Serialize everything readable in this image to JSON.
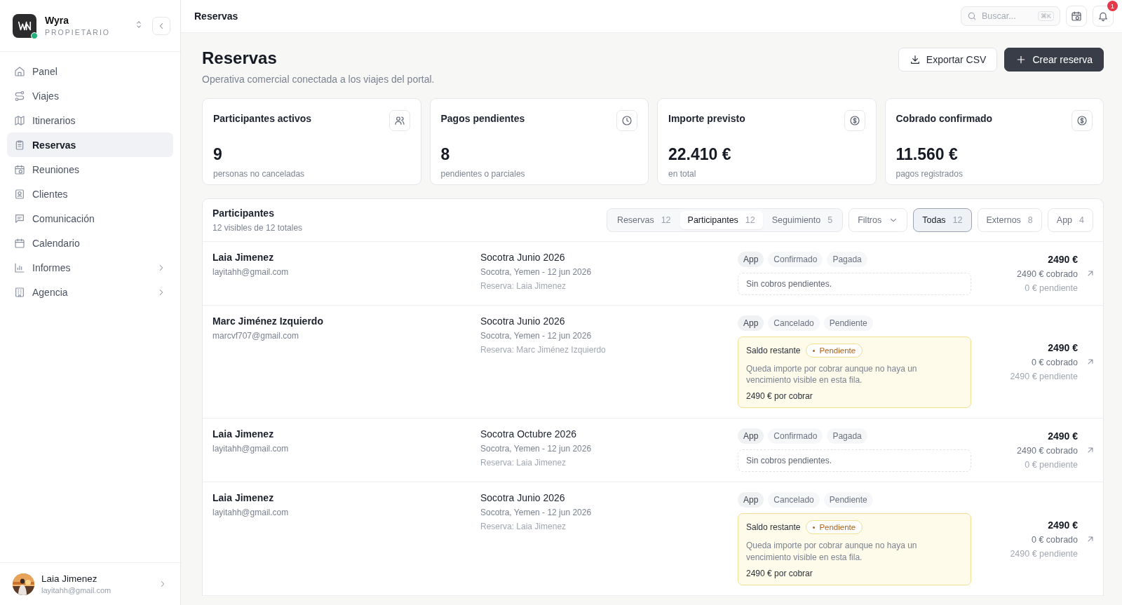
{
  "sidebar": {
    "brand": {
      "name": "Wyra",
      "role": "PROPIETARIO"
    },
    "items": [
      {
        "label": "Panel",
        "selected": false,
        "expandable": false
      },
      {
        "label": "Viajes",
        "selected": false,
        "expandable": false
      },
      {
        "label": "Itinerarios",
        "selected": false,
        "expandable": false
      },
      {
        "label": "Reservas",
        "selected": true,
        "expandable": false
      },
      {
        "label": "Reuniones",
        "selected": false,
        "expandable": false
      },
      {
        "label": "Clientes",
        "selected": false,
        "expandable": false
      },
      {
        "label": "Comunicación",
        "selected": false,
        "expandable": false
      },
      {
        "label": "Calendario",
        "selected": false,
        "expandable": false
      },
      {
        "label": "Informes",
        "selected": false,
        "expandable": true
      },
      {
        "label": "Agencia",
        "selected": false,
        "expandable": true
      }
    ],
    "user": {
      "name": "Laia Jimenez",
      "email": "layitahh@gmail.com"
    }
  },
  "topbar": {
    "title": "Reservas",
    "search": {
      "placeholder": "Buscar...",
      "shortcut": "⌘K"
    },
    "notifications": "1"
  },
  "header": {
    "title": "Reservas",
    "subtitle": "Operativa comercial conectada a los viajes del portal.",
    "buttons": [
      {
        "label": "Exportar CSV",
        "kind": "secondary"
      },
      {
        "label": "Crear reserva",
        "kind": "primary"
      }
    ]
  },
  "stats": [
    {
      "title": "Participantes activos",
      "value": "9",
      "caption": "personas no canceladas"
    },
    {
      "title": "Pagos pendientes",
      "value": "8",
      "caption": "pendientes o parciales"
    },
    {
      "title": "Importe previsto",
      "value": "22.410 €",
      "caption": "en total"
    },
    {
      "title": "Cobrado confirmado",
      "value": "11.560 €",
      "caption": "pagos registrados"
    }
  ],
  "participants": {
    "title": "Participantes",
    "subtitle": "12 visibles de 12 totales",
    "view_tabs": [
      {
        "label": "Reservas",
        "count": "12",
        "selected": false
      },
      {
        "label": "Participantes",
        "count": "12",
        "selected": true
      },
      {
        "label": "Seguimiento",
        "count": "5",
        "selected": false
      }
    ],
    "filters_button": "Filtros",
    "segments": [
      {
        "label": "Todas",
        "count": "12",
        "selected": true
      },
      {
        "label": "Externos",
        "count": "8",
        "selected": false
      },
      {
        "label": "App",
        "count": "4",
        "selected": false
      }
    ],
    "rows": [
      {
        "name": "Laia Jimenez",
        "email": "layitahh@gmail.com",
        "trip": "Socotra Junio 2026",
        "place_date": "Socotra, Yemen - 12 jun 2026",
        "reservation": "Reserva: Laia Jimenez",
        "tags": [
          {
            "label": "App",
            "kind": "source"
          },
          {
            "label": "Confirmado",
            "kind": "status"
          },
          {
            "label": "Pagada",
            "kind": "status"
          }
        ],
        "payment": {
          "kind": "none",
          "text": "Sin cobros pendientes."
        },
        "total": "2490 €",
        "collected": "2490 € cobrado",
        "pending": "0 € pendiente"
      },
      {
        "name": "Marc Jiménez Izquierdo",
        "email": "marcvf707@gmail.com",
        "trip": "Socotra Junio 2026",
        "place_date": "Socotra, Yemen - 12 jun 2026",
        "reservation": "Reserva: Marc Jiménez Izquierdo",
        "tags": [
          {
            "label": "App",
            "kind": "source"
          },
          {
            "label": "Cancelado",
            "kind": "status"
          },
          {
            "label": "Pendiente",
            "kind": "status"
          }
        ],
        "payment": {
          "kind": "pending",
          "title": "Saldo restante",
          "badge": "Pendiente",
          "text": "Queda importe por cobrar aunque no haya un vencimiento visible en esta fila.",
          "amount": "2490 € por cobrar"
        },
        "total": "2490 €",
        "collected": "0 € cobrado",
        "pending": "2490 € pendiente"
      },
      {
        "name": "Laia Jimenez",
        "email": "layitahh@gmail.com",
        "trip": "Socotra Octubre 2026",
        "place_date": "Socotra, Yemen - 12 jun 2026",
        "reservation": "Reserva: Laia Jimenez",
        "tags": [
          {
            "label": "App",
            "kind": "source"
          },
          {
            "label": "Confirmado",
            "kind": "status"
          },
          {
            "label": "Pagada",
            "kind": "status"
          }
        ],
        "payment": {
          "kind": "none",
          "text": "Sin cobros pendientes."
        },
        "total": "2490 €",
        "collected": "2490 € cobrado",
        "pending": "0 € pendiente"
      },
      {
        "name": "Laia Jimenez",
        "email": "layitahh@gmail.com",
        "trip": "Socotra Junio 2026",
        "place_date": "Socotra, Yemen - 12 jun 2026",
        "reservation": "Reserva: Laia Jimenez",
        "tags": [
          {
            "label": "App",
            "kind": "source"
          },
          {
            "label": "Cancelado",
            "kind": "status"
          },
          {
            "label": "Pendiente",
            "kind": "status"
          }
        ],
        "payment": {
          "kind": "pending",
          "title": "Saldo restante",
          "badge": "Pendiente",
          "text": "Queda importe por cobrar aunque no haya un vencimiento visible en esta fila.",
          "amount": "2490 € por cobrar"
        },
        "total": "2490 €",
        "collected": "0 € cobrado",
        "pending": "2490 € pendiente"
      }
    ]
  }
}
